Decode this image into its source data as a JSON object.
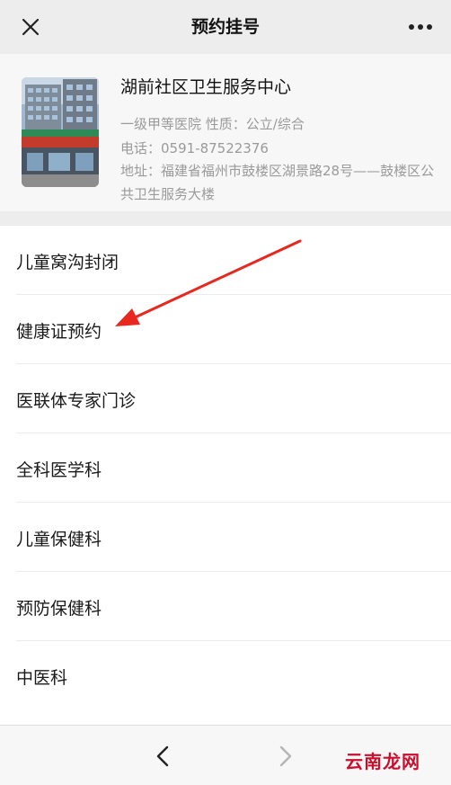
{
  "header": {
    "close_icon": "close-icon",
    "title": "预约挂号",
    "more_icon": "more-icon"
  },
  "hospital": {
    "name": "湖前社区卫生服务中心",
    "grade_line": "一级甲等医院 性质：公立/综合",
    "phone_line": "电话：0591-87522376",
    "address_line": "地址：福建省福州市鼓楼区湖景路28号——鼓楼区公共卫生服务大楼"
  },
  "departments": [
    {
      "label": "儿童窝沟封闭"
    },
    {
      "label": "健康证预约"
    },
    {
      "label": "医联体专家门诊"
    },
    {
      "label": "全科医学科"
    },
    {
      "label": "儿童保健科"
    },
    {
      "label": "预防保健科"
    },
    {
      "label": "中医科"
    }
  ],
  "footer": {
    "back_icon": "chevron-left-icon",
    "forward_icon": "chevron-right-icon",
    "watermark": "云南龙网"
  },
  "colors": {
    "annotation_arrow": "#e8271e",
    "watermark": "#c8102e"
  }
}
